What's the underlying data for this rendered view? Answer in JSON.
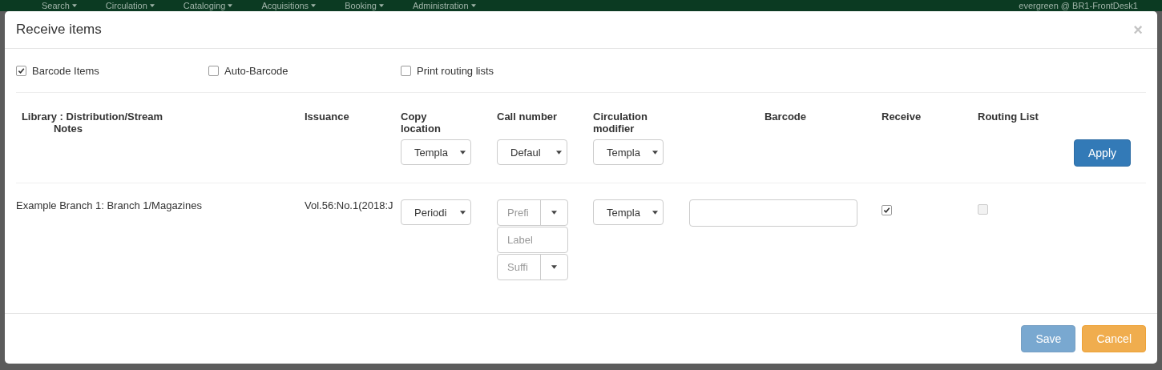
{
  "background_nav": {
    "items": [
      "Search",
      "Circulation",
      "Cataloging",
      "Acquisitions",
      "Booking",
      "Administration"
    ],
    "user": "evergreen @ BR1-FrontDesk1"
  },
  "dialog": {
    "title": "Receive items",
    "close": "×"
  },
  "options": [
    {
      "label": "Barcode Items",
      "checked": true
    },
    {
      "label": "Auto-Barcode",
      "checked": false
    },
    {
      "label": "Print routing lists",
      "checked": false
    }
  ],
  "columns": [
    {
      "label": "Library : Distribution/Stream",
      "sublabel": "Notes"
    },
    {
      "label": "Issuance"
    },
    {
      "label": "Copy location"
    },
    {
      "label": "Call number"
    },
    {
      "label": "Circulation modifier"
    },
    {
      "label": "Barcode"
    },
    {
      "label": "Receive"
    },
    {
      "label": "Routing List"
    }
  ],
  "batch": {
    "copy_location": "Templa",
    "call_number": "Defaul",
    "circ_modifier": "Templa",
    "apply": "Apply"
  },
  "rows": [
    {
      "library": "Example Branch 1: Branch 1/Magazines",
      "issuance": "Vol.56:No.1(2018:J",
      "copy_location": "Periodi",
      "prefix": "Prefi",
      "label": "Label",
      "suffix": "Suffi",
      "circ_modifier": "Templa",
      "receive": true,
      "routing": false,
      "routing_disabled": true
    }
  ],
  "footer": [
    {
      "label": "Save",
      "kind": "primary",
      "disabled": true
    },
    {
      "label": "Cancel",
      "kind": "warning",
      "disabled": false
    }
  ]
}
